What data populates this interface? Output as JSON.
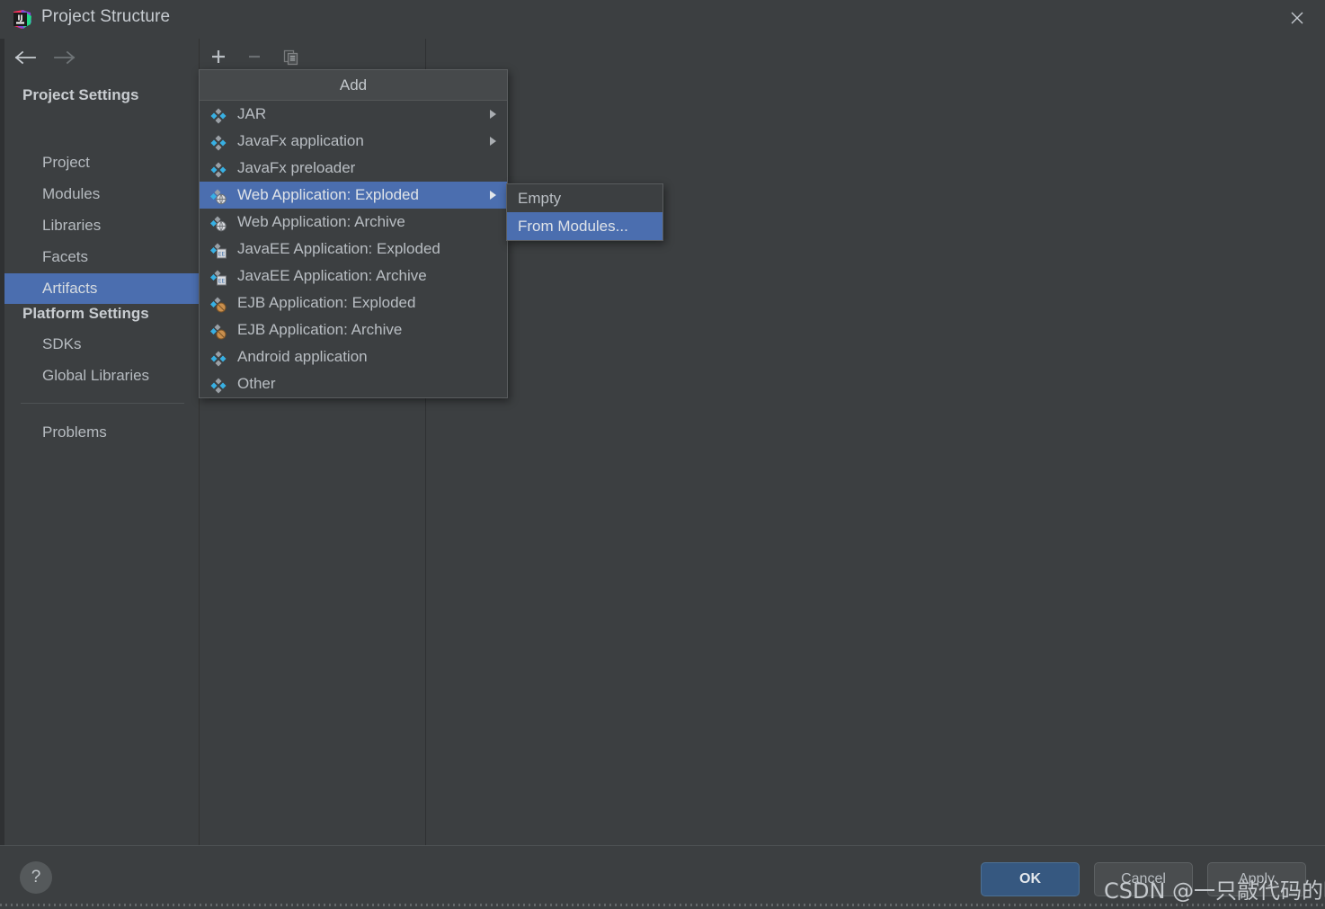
{
  "window": {
    "title": "Project Structure",
    "logo_icon": "intellij-idea-logo",
    "close_icon": "close-icon"
  },
  "sidebar": {
    "back_icon": "arrow-left-icon",
    "forward_icon": "arrow-right-icon",
    "groups": [
      {
        "label": "Project Settings"
      },
      {
        "label": "Platform Settings"
      }
    ],
    "items": [
      {
        "label": "Project",
        "selected": false
      },
      {
        "label": "Modules",
        "selected": false
      },
      {
        "label": "Libraries",
        "selected": false
      },
      {
        "label": "Facets",
        "selected": false
      },
      {
        "label": "Artifacts",
        "selected": true
      },
      {
        "label": "SDKs",
        "selected": false
      },
      {
        "label": "Global Libraries",
        "selected": false
      },
      {
        "label": "Problems",
        "selected": false
      }
    ]
  },
  "toolbar": {
    "add_icon": "plus-icon",
    "remove_icon": "minus-icon",
    "copy_icon": "copy-icon"
  },
  "add_menu": {
    "header": "Add",
    "items": [
      {
        "label": "JAR",
        "icon": "artifact-icon",
        "submenu": true,
        "selected": false
      },
      {
        "label": "JavaFx application",
        "icon": "artifact-icon",
        "submenu": true,
        "selected": false
      },
      {
        "label": "JavaFx preloader",
        "icon": "artifact-icon",
        "submenu": false,
        "selected": false
      },
      {
        "label": "Web Application: Exploded",
        "icon": "web-artifact-icon",
        "submenu": true,
        "selected": true
      },
      {
        "label": "Web Application: Archive",
        "icon": "web-artifact-icon",
        "submenu": false,
        "selected": false
      },
      {
        "label": "JavaEE Application: Exploded",
        "icon": "javaee-artifact-icon",
        "submenu": false,
        "selected": false
      },
      {
        "label": "JavaEE Application: Archive",
        "icon": "javaee-artifact-icon",
        "submenu": false,
        "selected": false
      },
      {
        "label": "EJB Application: Exploded",
        "icon": "ejb-artifact-icon",
        "submenu": false,
        "selected": false
      },
      {
        "label": "EJB Application: Archive",
        "icon": "ejb-artifact-icon",
        "submenu": false,
        "selected": false
      },
      {
        "label": "Android application",
        "icon": "artifact-icon",
        "submenu": false,
        "selected": false
      },
      {
        "label": "Other",
        "icon": "artifact-icon",
        "submenu": false,
        "selected": false
      }
    ]
  },
  "submenu": {
    "items": [
      {
        "label": "Empty",
        "selected": false
      },
      {
        "label": "From Modules...",
        "selected": true
      }
    ]
  },
  "bottom": {
    "help_label": "?",
    "ok_label": "OK",
    "cancel_label": "Cancel",
    "apply_label": "Apply"
  },
  "watermark": {
    "text": "CSDN @一只敲代码的嗷呜"
  },
  "colors": {
    "background": "#3c3f41",
    "selection": "#4b6eaf",
    "ok_button": "#365880",
    "icon_blue": "#38b0e3",
    "icon_gray": "#9aa0a6"
  }
}
